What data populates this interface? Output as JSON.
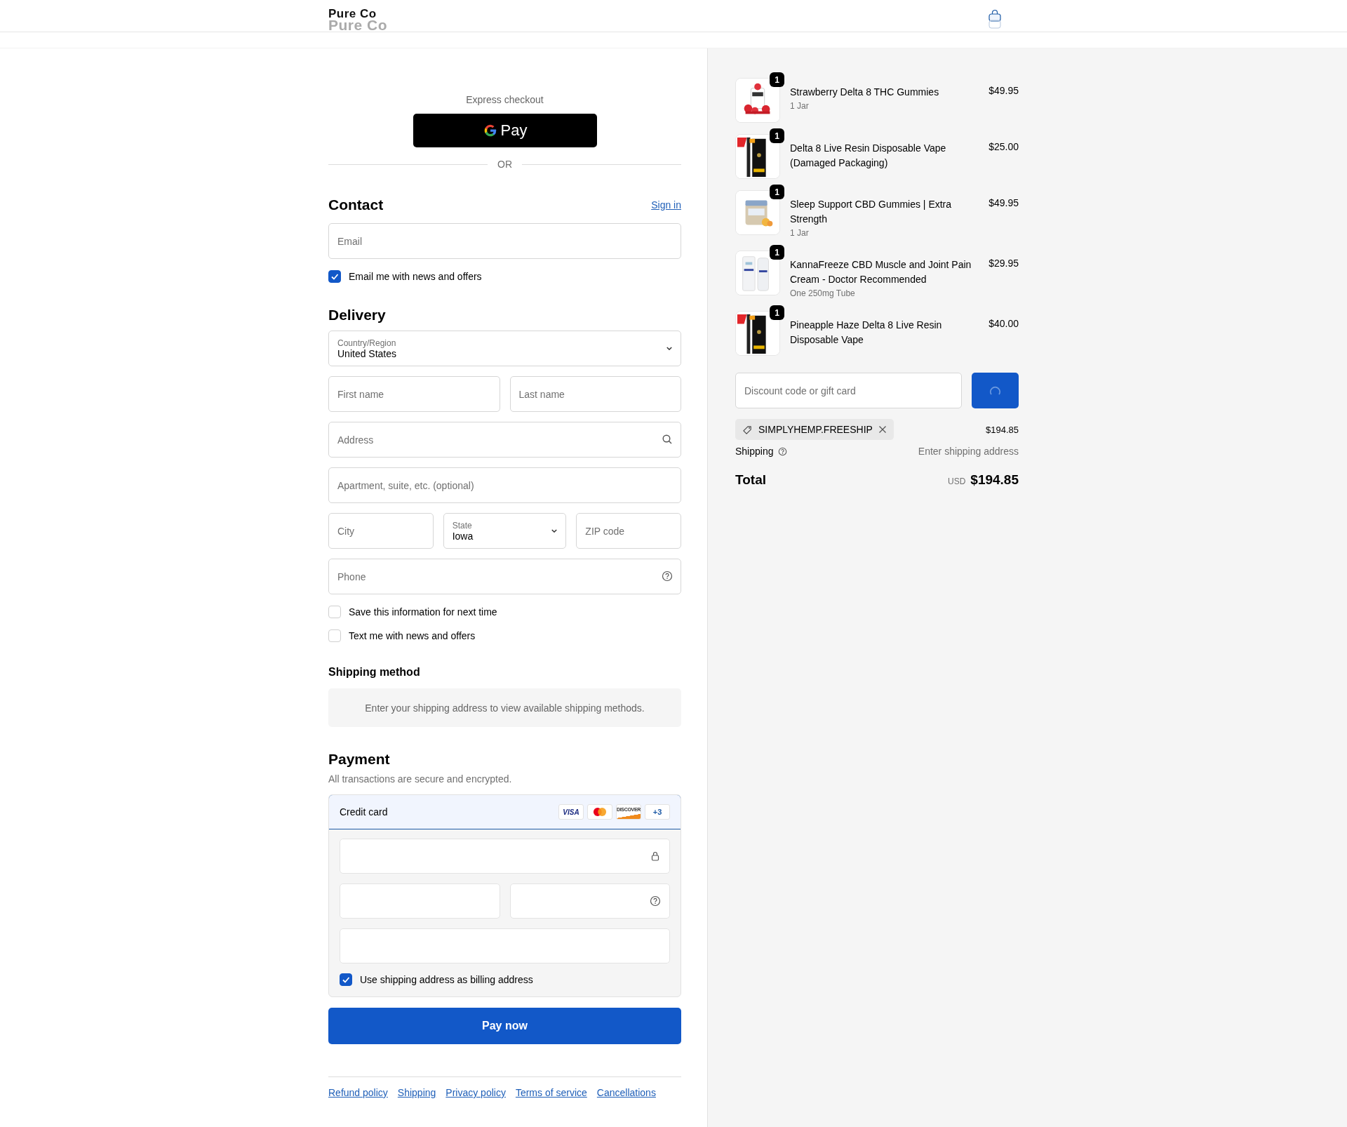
{
  "header": {
    "logo": "Pure Co",
    "logo_ghost": "Pure Co"
  },
  "express": {
    "title": "Express checkout",
    "gpay_label": "Pay",
    "divider": "OR"
  },
  "contact": {
    "title": "Contact",
    "sign_in": "Sign in",
    "email": {
      "placeholder": "Email"
    },
    "newsletter": {
      "label": "Email me with news and offers",
      "checked": true
    }
  },
  "delivery": {
    "title": "Delivery",
    "rows": [
      [
        {
          "kind": "select",
          "label": "Country/Region",
          "value": "United States"
        }
      ],
      [
        {
          "kind": "input",
          "placeholder": "First name"
        },
        {
          "kind": "input",
          "placeholder": "Last name"
        }
      ],
      [
        {
          "kind": "address",
          "placeholder": "Address"
        }
      ],
      [
        {
          "kind": "input",
          "placeholder": "Apartment, suite, etc. (optional)"
        }
      ],
      [
        {
          "kind": "input",
          "placeholder": "City"
        },
        {
          "kind": "select",
          "label": "State",
          "value": "Iowa"
        },
        {
          "kind": "input",
          "placeholder": "ZIP code"
        }
      ],
      [
        {
          "kind": "phone",
          "placeholder": "Phone"
        }
      ]
    ],
    "options": [
      {
        "label": "Save this information for next time",
        "checked": false
      },
      {
        "label": "Text me with news and offers",
        "checked": false
      }
    ]
  },
  "shipping_method": {
    "title": "Shipping method",
    "message": "Enter your shipping address to view available shipping methods."
  },
  "payment": {
    "title": "Payment",
    "subtitle": "All transactions are secure and encrypted.",
    "method": "Credit card",
    "brands": [
      {
        "kind": "visa",
        "text": "VISA"
      },
      {
        "kind": "mastercard"
      },
      {
        "kind": "discover",
        "text": "DISCOVER"
      },
      {
        "kind": "more",
        "text": "+3"
      }
    ],
    "billing": {
      "label": "Use shipping address as billing address",
      "checked": true
    },
    "pay_button": "Pay now"
  },
  "footer_links": [
    "Refund policy",
    "Shipping",
    "Privacy policy",
    "Terms of service",
    "Cancellations"
  ],
  "cart": {
    "items": [
      {
        "name": "Strawberry Delta 8 THC Gummies",
        "variant": "1 Jar",
        "price": "$49.95",
        "quantity": "1",
        "kind": "gummies"
      },
      {
        "name": "Delta 8 Live Resin Disposable Vape (Damaged Packaging)",
        "price": "$25.00",
        "quantity": "1",
        "kind": "vape"
      },
      {
        "name": "Sleep Support CBD Gummies | Extra Strength",
        "variant": "1 Jar",
        "price": "$49.95",
        "quantity": "1",
        "kind": "jar"
      },
      {
        "name": "KannaFreeze CBD Muscle and Joint Pain Cream - Doctor Recommended",
        "variant": "One 250mg Tube",
        "price": "$29.95",
        "quantity": "1",
        "kind": "cream"
      },
      {
        "name": "Pineapple Haze Delta 8 Live Resin Disposable Vape",
        "price": "$40.00",
        "quantity": "1",
        "kind": "vape"
      }
    ],
    "discount": {
      "placeholder": "Discount code or gift card"
    },
    "applied_code": "SIMPLYHEMP.FREESHIP",
    "subtotal": "$194.85",
    "shipping_label": "Shipping",
    "shipping_value": "Enter shipping address",
    "total_label": "Total",
    "currency": "USD",
    "total": "$194.85"
  }
}
